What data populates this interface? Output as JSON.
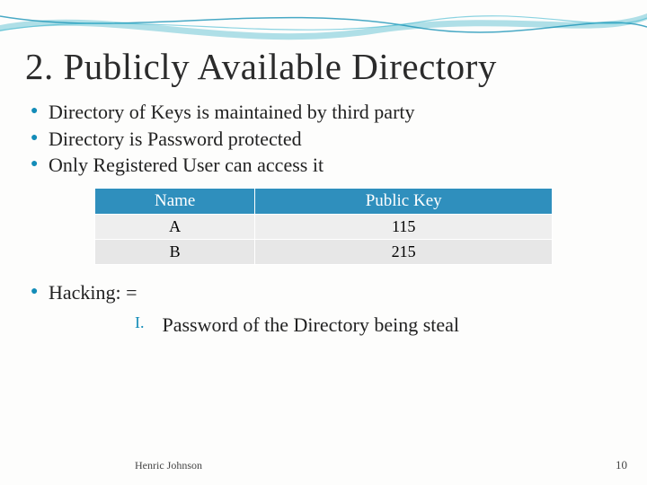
{
  "slide": {
    "title": "2. Publicly Available Directory",
    "bullets": [
      "Directory of Keys is maintained by third party",
      "Directory is Password protected",
      "Only Registered User can access it"
    ],
    "table": {
      "headers": [
        "Name",
        "Public Key"
      ],
      "rows": [
        [
          "A",
          "115"
        ],
        [
          "B",
          "215"
        ]
      ]
    },
    "hacking_label": "Hacking: =",
    "hacking_item_num": "I.",
    "hacking_item_text": "Password of the Directory being steal",
    "footer_author": "Henric Johnson",
    "footer_page": "10"
  }
}
